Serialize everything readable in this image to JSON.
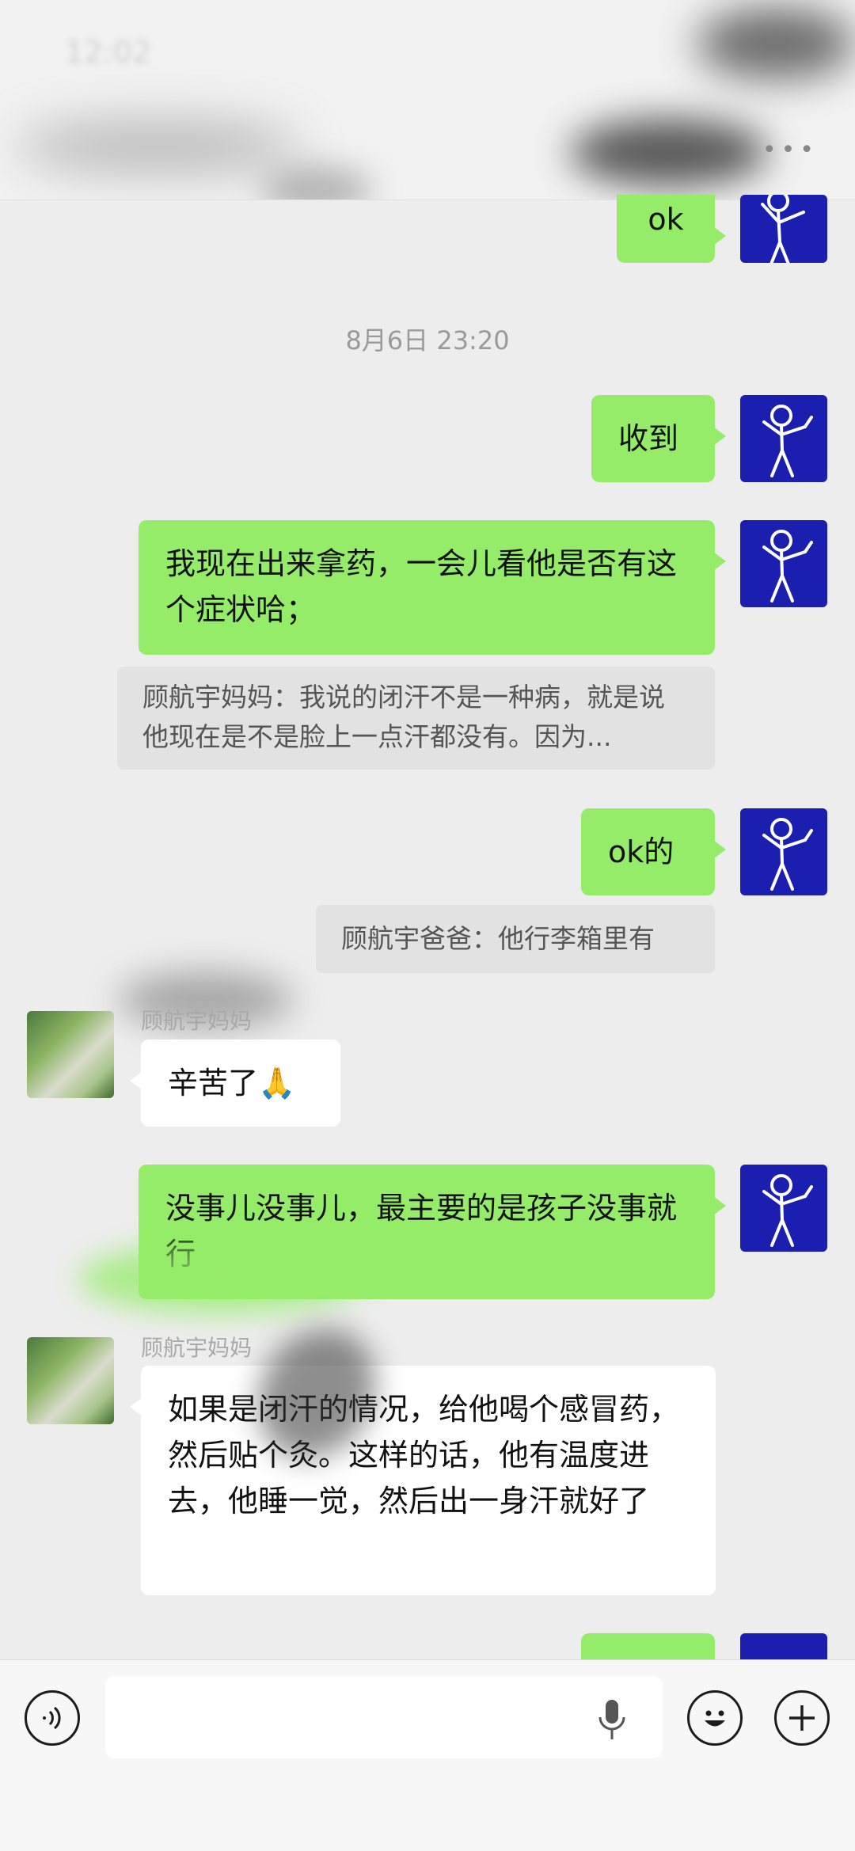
{
  "chat": {
    "timestamp": "8月6日 23:20",
    "messages": [
      {
        "text": "ok"
      },
      {
        "text": "收到"
      },
      {
        "text": "我现在出来拿药，一会儿看他是否有这个症状哈；"
      },
      {
        "text": "顾航宇妈妈：我说的闭汗不是一种病，就是说他现在是不是脸上一点汗都没有。因为..."
      },
      {
        "text": "ok的"
      },
      {
        "text": "顾航宇爸爸：他行李箱里有"
      },
      {
        "sender": "顾航宇妈妈",
        "text": "辛苦了🙏"
      },
      {
        "text": "没事儿没事儿，最主要的是孩子没事就行"
      },
      {
        "sender": "顾航宇妈妈",
        "text": "如果是闭汗的情况，给他喝个感冒药，然后贴个灸。这样的话，他有温度进去，他睡一觉，然后出一身汗就好了"
      }
    ]
  },
  "icons": {
    "voice": "voice-toggle-icon",
    "mic": "mic-icon",
    "emoji": "emoji-icon",
    "plus": "plus-icon"
  },
  "colors": {
    "outgoing_bubble": "#95ec69",
    "incoming_bubble": "#ffffff",
    "background": "#ededed",
    "my_avatar": "#1a1fb0"
  }
}
